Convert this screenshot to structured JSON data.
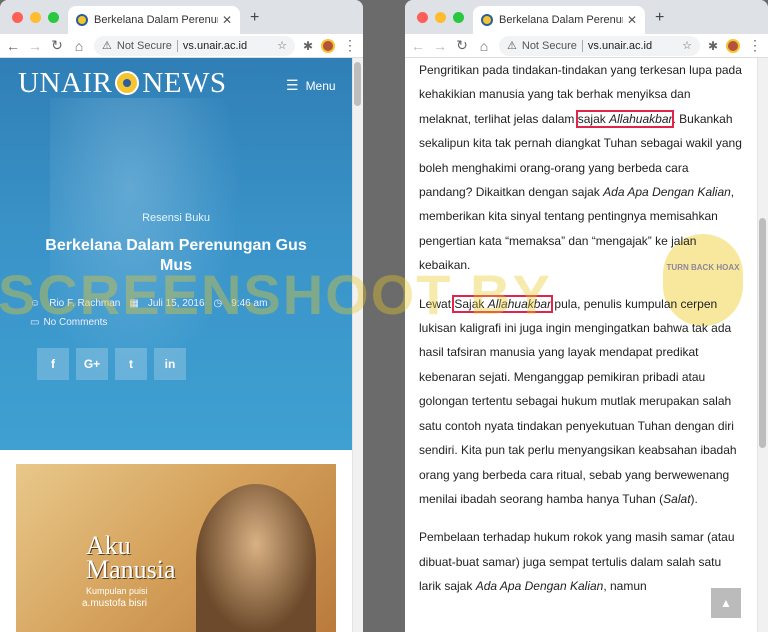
{
  "left_window": {
    "tab_title": "Berkelana Dalam Perenungan G",
    "address": {
      "security": "Not Secure",
      "host": "vs.unair.ac.id"
    },
    "site": {
      "logo_left": "UNAIR",
      "logo_right": "NEWS",
      "menu_label": "Menu"
    },
    "post": {
      "category": "Resensi Buku",
      "title": "Berkelana Dalam Perenungan Gus Mus",
      "author": "Rio F. Rachman",
      "date": "Juli 15, 2016",
      "time": "9:46 am",
      "comments": "No Comments",
      "share": [
        {
          "icon": "facebook-icon",
          "glyph": "f"
        },
        {
          "icon": "google-plus-icon",
          "glyph": "G+"
        },
        {
          "icon": "twitter-icon",
          "glyph": "t"
        },
        {
          "icon": "linkedin-icon",
          "glyph": "in"
        }
      ]
    },
    "cover": {
      "title_line1": "Aku",
      "title_line2": "Manusia",
      "subtitle": "Kumpulan puisi",
      "author": "a.mustofa bisri"
    }
  },
  "right_window": {
    "tab_title": "Berkelana Dalam Perenungan G",
    "address": {
      "security": "Not Secure",
      "host": "vs.unair.ac.id"
    },
    "paragraphs": {
      "p1_before": "Pengritikan pada tindakan-tindakan yang terkesan lupa pada kehakikian manusia yang tak berhak menyiksa dan melaknat, terlihat jelas dalam ",
      "p1_hl_plain": "sajak ",
      "p1_hl_em": "Allahuakbar",
      "p1_mid": ". Bukankah sekalipun kita tak pernah diangkat Tuhan sebagai wakil yang boleh menghakimi orang-orang yang berbeda cara pandang? Dikaitkan dengan sajak ",
      "p1_em2": "Ada Apa Dengan Kalian",
      "p1_after": ", memberikan kita sinyal tentang pentingnya memisahkan pengertian kata “memaksa” dan “mengajak” ke jalan kebaikan.",
      "p2_before": "Lewat ",
      "p2_hl_plain": "Sajak ",
      "p2_hl_em": "Allahuakbar",
      "p2_after": " pula, penulis kumpulan cerpen lukisan kaligrafi ini juga ingin mengingatkan bahwa tak ada hasil tafsiran manusia yang layak mendapat predikat kebenaran sejati. Menganggap pemikiran  pribadi atau golongan tertentu sebagai hukum mutlak merupakan salah satu contoh nyata tindakan penyekutuan Tuhan dengan diri sendiri. Kita pun tak perlu menyangsikan keabsahan ibadah orang yang berbeda cara ritual, sebab yang berwewenang menilai ibadah seorang hamba hanya Tuhan (",
      "p2_em": "Salat",
      "p2_end": ").",
      "p3_before": "Pembelaan terhadap hukum rokok yang masih samar (atau dibuat-buat samar) juga sempat tertulis dalam salah satu larik sajak ",
      "p3_em": "Ada Apa Dengan Kalian",
      "p3_after": ", namun"
    },
    "stamp_text": "TURN BACK HOAX"
  },
  "watermark": "SCREENSHOOT BY"
}
